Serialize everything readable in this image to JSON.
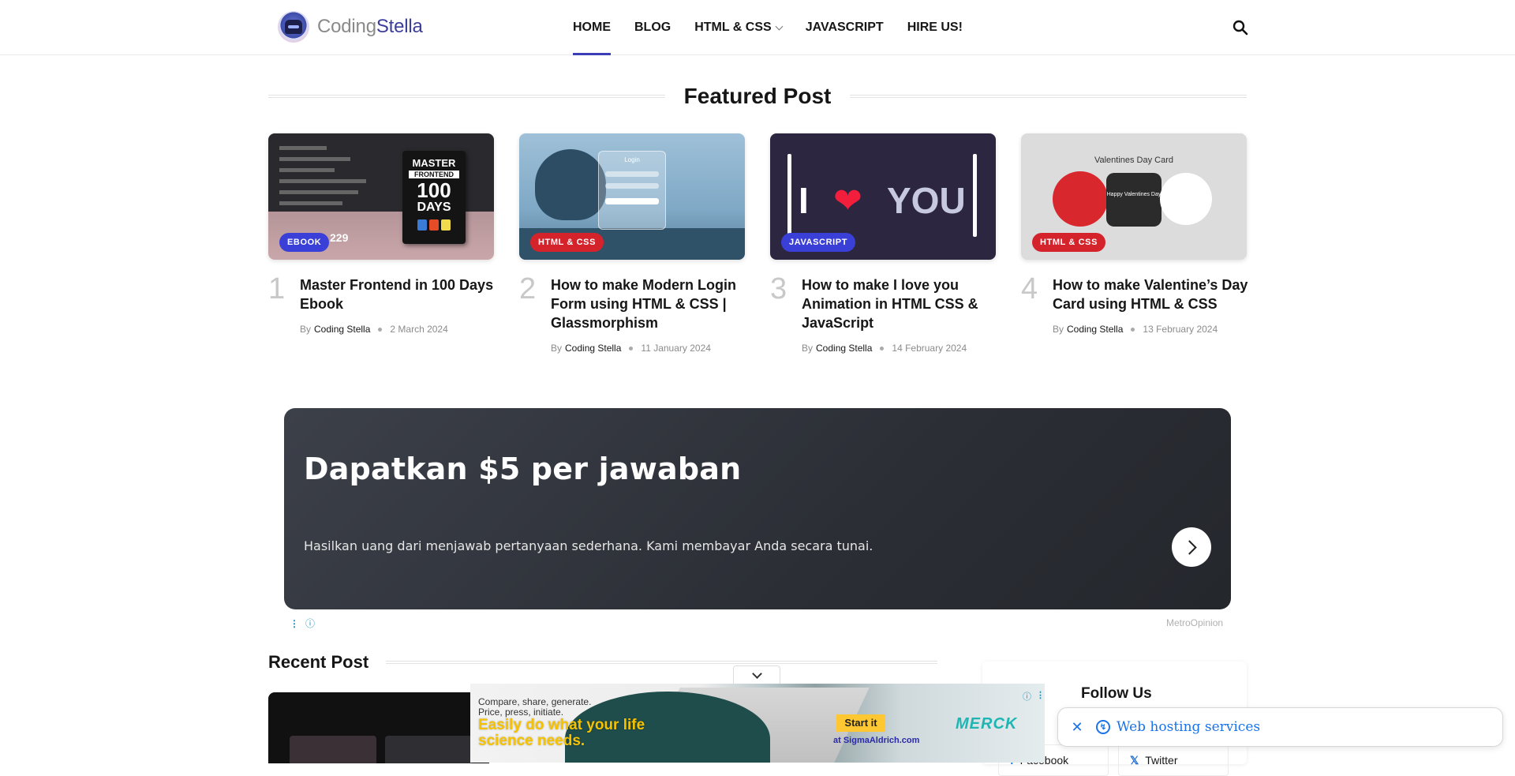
{
  "brand": {
    "name_prefix": "Coding",
    "name_suffix": "Stella"
  },
  "nav": {
    "items": [
      {
        "label": "HOME"
      },
      {
        "label": "BLOG"
      },
      {
        "label": "HTML & CSS"
      },
      {
        "label": "JAVASCRIPT"
      },
      {
        "label": "HIRE US!"
      }
    ]
  },
  "featured": {
    "heading": "Featured Post",
    "posts": [
      {
        "rank": "1",
        "category": "EBOOK",
        "title": "Master Frontend in 100 Days Ebook",
        "by": "By",
        "author": "Coding Stella",
        "date": "2 March 2024"
      },
      {
        "rank": "2",
        "category": "HTML & CSS",
        "title": "How to make Modern Login Form using HTML & CSS | Glassmorphism",
        "by": "By",
        "author": "Coding Stella",
        "date": "11 January 2024"
      },
      {
        "rank": "3",
        "category": "JAVASCRIPT",
        "title": "How to make I love you Animation in HTML CSS & JavaScript",
        "by": "By",
        "author": "Coding Stella",
        "date": "14 February 2024"
      },
      {
        "rank": "4",
        "category": "HTML & CSS",
        "title": "How to make Valentine’s Day Card using HTML & CSS",
        "by": "By",
        "author": "Coding Stella",
        "date": "13 February 2024"
      }
    ],
    "thumb_text": {
      "ebook_line1": "MASTER",
      "ebook_line2": "FRONTEND",
      "ebook_line3": "100",
      "ebook_line4": "DAYS",
      "ebook_price": "229",
      "login_title": "Login",
      "love_i": "I",
      "love_you": "YOU",
      "valentine_title": "Valentines Day Card",
      "valentine_card": "Happy Valentines Day"
    }
  },
  "ad": {
    "title": "Dapatkan $5 per jawaban",
    "text": "Hasilkan uang dari menjawab pertanyaan sederhana. Kami membayar Anda secara tunai.",
    "source": "MetroOpinion"
  },
  "recent": {
    "heading": "Recent Post"
  },
  "sidebar": {
    "follow_title": "Follow Us",
    "social": [
      {
        "label": "Facebook"
      },
      {
        "label": "Twitter"
      }
    ]
  },
  "bottom_ad": {
    "small_text": "Compare, share, generate.\nPrice, press, initiate.",
    "big_text": "Easily do what your life science needs.",
    "cta": "Start it",
    "url": "at SigmaAldrich.com",
    "brand": "MERCK"
  },
  "popup": {
    "text": "Web hosting services"
  },
  "colors": {
    "accent": "#3a3fb8",
    "category_blue": "#3a3fd8",
    "category_red": "#d4232b",
    "link_blue": "#1a73e8"
  }
}
